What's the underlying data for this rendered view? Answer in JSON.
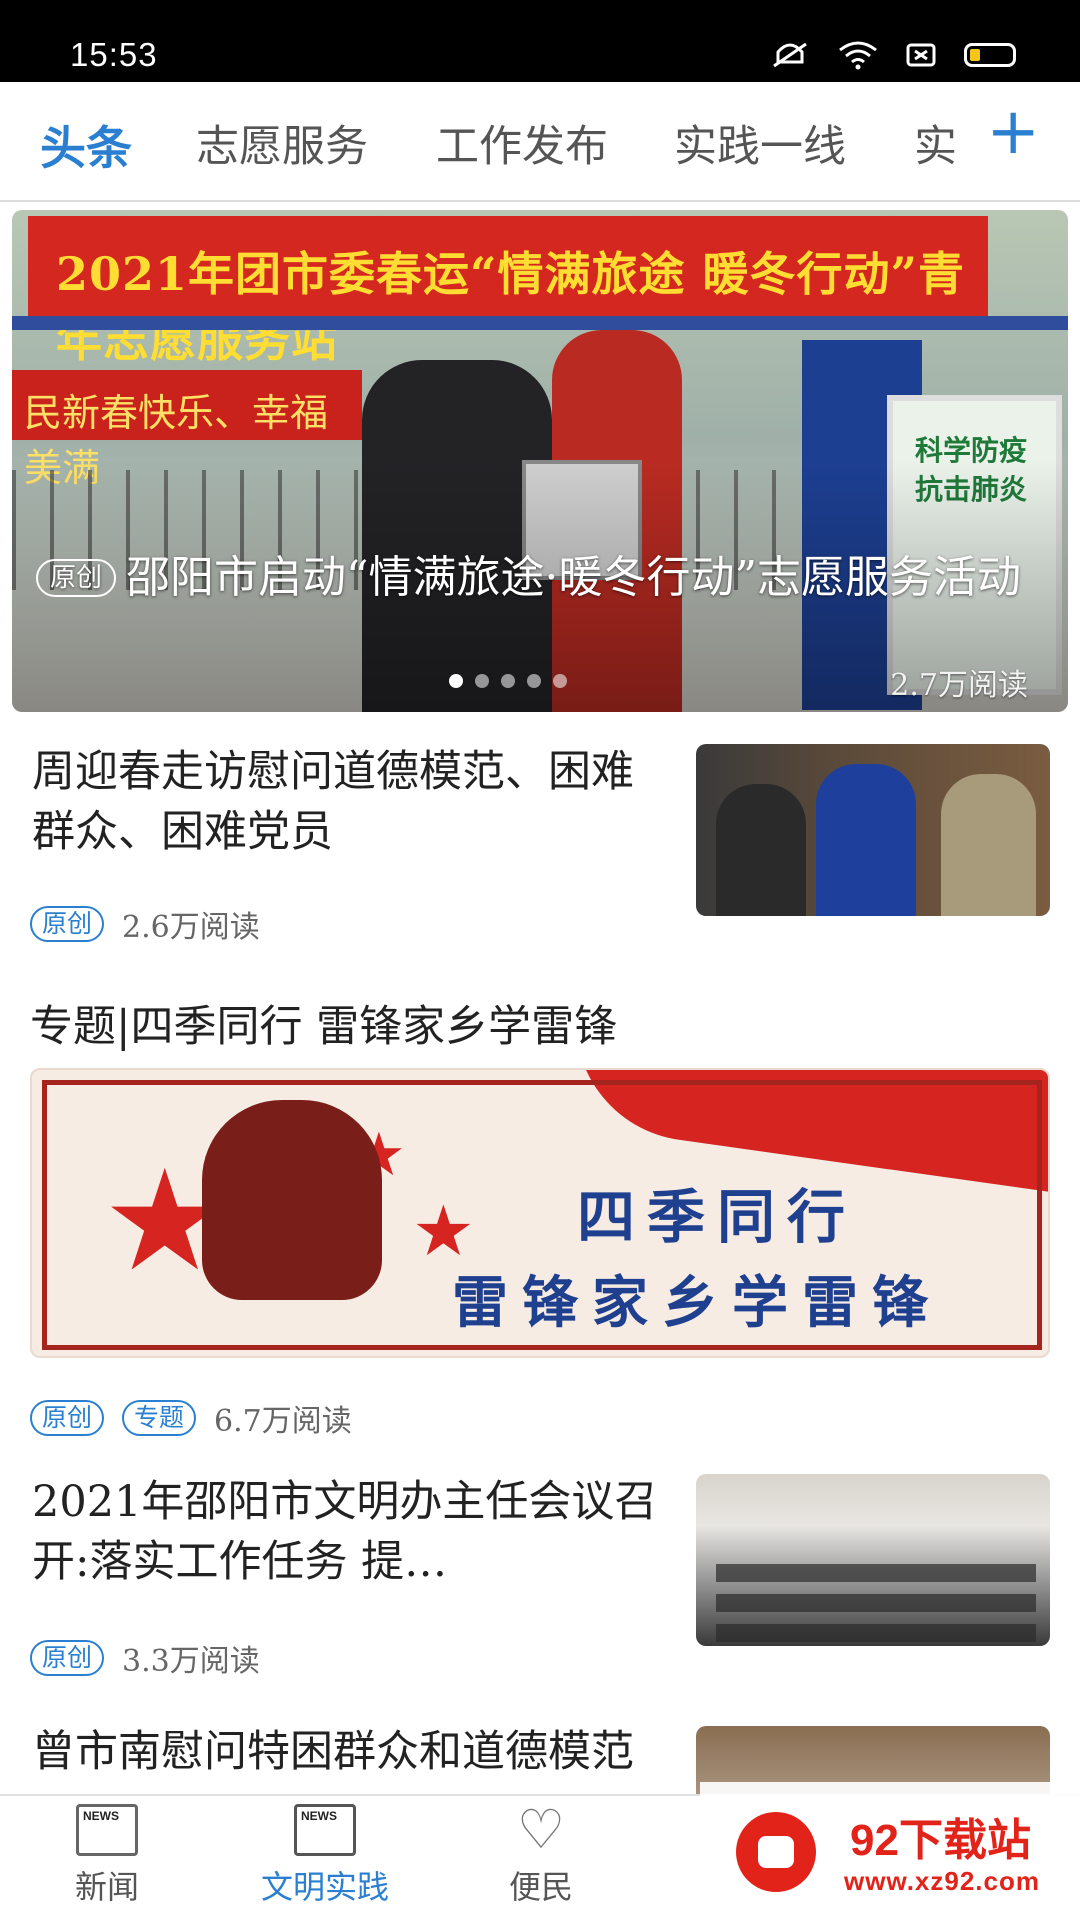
{
  "status_bar": {
    "time": "15:53"
  },
  "tabs": {
    "items": [
      {
        "label": "头条",
        "active": true
      },
      {
        "label": "志愿服务"
      },
      {
        "label": "工作发布"
      },
      {
        "label": "实践一线"
      },
      {
        "label": "实"
      }
    ],
    "add_label": "+"
  },
  "hero": {
    "banner_text": "2021年团市委春运“情满旅途 暖冬行动”青年志愿服务站",
    "left_sign_text": "民新春快乐、幸福美满",
    "board_text": "科学防疫\n抗击肺炎",
    "badge": "原创",
    "title": "邵阳市启动“情满旅途·暖冬行动”志愿服务活动",
    "reads": "2.7万阅读",
    "dots": 5,
    "active_dot": 0
  },
  "articles": [
    {
      "title": "周迎春走访慰问道德模范、困难群众、困难党员",
      "badges": [
        "原创"
      ],
      "reads": "2.6万阅读"
    },
    {
      "title": "2021年邵阳市文明办主任会议召开:落实工作任务 提…",
      "badges": [
        "原创"
      ],
      "reads": "3.3万阅读"
    },
    {
      "title": "曾市南慰问特困群众和道德模范"
    }
  ],
  "topic": {
    "title": "专题|四季同行  雷锋家乡学雷锋",
    "banner_line1": "四季同行",
    "banner_line2": "雷锋家乡学雷锋",
    "badges": [
      "原创",
      "专题"
    ],
    "reads": "6.7万阅读"
  },
  "bottom_nav": {
    "items": [
      {
        "label": "新闻",
        "icon_text": "NEWS"
      },
      {
        "label": "文明实践",
        "icon_text": "NEWS",
        "active": true
      },
      {
        "label": "便民"
      }
    ]
  },
  "watermark": {
    "brand": "92下载站",
    "url": "www.xz92.com"
  },
  "colors": {
    "accent": "#2a7fd1",
    "status_bar": "#000000",
    "watermark_red": "#e2231a"
  }
}
